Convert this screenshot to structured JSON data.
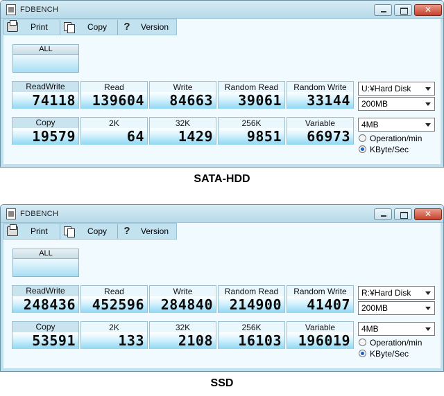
{
  "panels": [
    {
      "title": "FDBENCH",
      "toolbar": {
        "print": "Print",
        "copy": "Copy",
        "version": "Version"
      },
      "all_label": "ALL",
      "row1": [
        {
          "label": "ReadWrite",
          "value": "74118"
        },
        {
          "label": "Read",
          "value": "139604"
        },
        {
          "label": "Write",
          "value": "84663"
        },
        {
          "label": "Random Read",
          "value": "39061"
        },
        {
          "label": "Random Write",
          "value": "33144"
        }
      ],
      "row2": [
        {
          "label": "Copy",
          "value": "19579"
        },
        {
          "label": "2K",
          "value": "64"
        },
        {
          "label": "32K",
          "value": "1429"
        },
        {
          "label": "256K",
          "value": "9851"
        },
        {
          "label": "Variable",
          "value": "66973"
        }
      ],
      "drive": "U:¥Hard Disk",
      "size": "200MB",
      "block": "4MB",
      "radio_opmin": "Operation/min",
      "radio_kbsec": "KByte/Sec",
      "selected_unit": "KByte/Sec",
      "caption": "SATA-HDD"
    },
    {
      "title": "FDBENCH",
      "toolbar": {
        "print": "Print",
        "copy": "Copy",
        "version": "Version"
      },
      "all_label": "ALL",
      "row1": [
        {
          "label": "ReadWrite",
          "value": "248436"
        },
        {
          "label": "Read",
          "value": "452596"
        },
        {
          "label": "Write",
          "value": "284840"
        },
        {
          "label": "Random Read",
          "value": "214900"
        },
        {
          "label": "Random Write",
          "value": "41407"
        }
      ],
      "row2": [
        {
          "label": "Copy",
          "value": "53591"
        },
        {
          "label": "2K",
          "value": "133"
        },
        {
          "label": "32K",
          "value": "2108"
        },
        {
          "label": "256K",
          "value": "16103"
        },
        {
          "label": "Variable",
          "value": "196019"
        }
      ],
      "drive": "R:¥Hard Disk",
      "size": "200MB",
      "block": "4MB",
      "radio_opmin": "Operation/min",
      "radio_kbsec": "KByte/Sec",
      "selected_unit": "KByte/Sec",
      "caption": "SSD"
    }
  ]
}
